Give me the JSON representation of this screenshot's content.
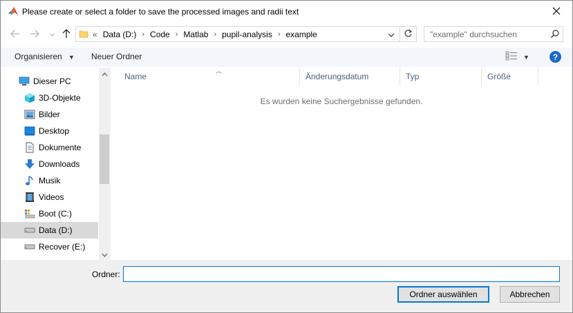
{
  "window": {
    "title": "Please create or select a folder to save the processed images and radii text"
  },
  "address": {
    "prefix": "«",
    "crumbs": [
      "Data (D:)",
      "Code",
      "Matlab",
      "pupil-analysis",
      "example"
    ]
  },
  "search": {
    "placeholder": "\"example\" durchsuchen"
  },
  "toolbar": {
    "organize_label": "Organisieren",
    "new_folder_label": "Neuer Ordner"
  },
  "nav_pane": {
    "items": [
      {
        "label": "Dieser PC",
        "icon": "this-pc-icon",
        "selected": false
      },
      {
        "label": "3D-Objekte",
        "icon": "3d-objects-icon",
        "selected": false
      },
      {
        "label": "Bilder",
        "icon": "pictures-icon",
        "selected": false
      },
      {
        "label": "Desktop",
        "icon": "desktop-icon",
        "selected": false
      },
      {
        "label": "Dokumente",
        "icon": "documents-icon",
        "selected": false
      },
      {
        "label": "Downloads",
        "icon": "downloads-icon",
        "selected": false
      },
      {
        "label": "Musik",
        "icon": "music-icon",
        "selected": false
      },
      {
        "label": "Videos",
        "icon": "videos-icon",
        "selected": false
      },
      {
        "label": "Boot (C:)",
        "icon": "system-drive-icon",
        "selected": false
      },
      {
        "label": "Data (D:)",
        "icon": "drive-icon",
        "selected": true
      },
      {
        "label": "Recover (E:)",
        "icon": "drive-icon",
        "selected": false
      }
    ]
  },
  "file_list": {
    "columns": [
      "Name",
      "Änderungsdatum",
      "Typ",
      "Größe"
    ],
    "empty_message": "Es wurden keine Suchergebnisse gefunden."
  },
  "footer": {
    "folder_label": "Ordner:",
    "folder_value": "",
    "select_button": "Ordner auswählen",
    "cancel_button": "Abbrechen"
  },
  "colors": {
    "accent": "#0078d7",
    "help": "#1b6ac9",
    "selected_bg": "#d9d9d9",
    "toolbar_bg": "#f3f6fb"
  }
}
